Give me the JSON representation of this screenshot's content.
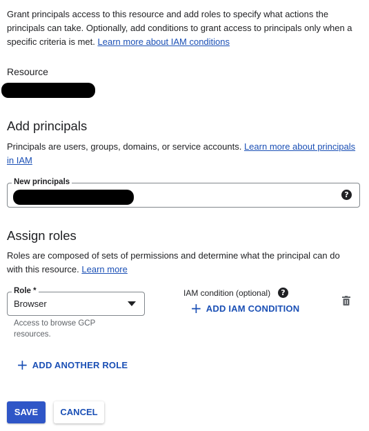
{
  "intro": {
    "text": "Grant principals access to this resource and add roles to specify what actions the principals can take. Optionally, add conditions to grant access to principals only when a specific criteria is met.",
    "link": "Learn more about IAM conditions"
  },
  "resource": {
    "label": "Resource"
  },
  "add_principals": {
    "heading": "Add principals",
    "description": "Principals are users, groups, domains, or service accounts.",
    "link": "Learn more about principals in IAM",
    "field_label": "New principals"
  },
  "assign_roles": {
    "heading": "Assign roles",
    "description": "Roles are composed of sets of permissions and determine what the principal can do with this resource.",
    "link": "Learn more",
    "role_label": "Role *",
    "role_value": "Browser",
    "role_hint": "Access to browse GCP resources.",
    "iam_condition_label": "IAM condition (optional)",
    "add_condition": "ADD IAM CONDITION",
    "add_role": "ADD ANOTHER ROLE"
  },
  "actions": {
    "save": "SAVE",
    "cancel": "CANCEL"
  },
  "icons": {
    "help": "help-icon",
    "dropdown": "caret-down-icon",
    "delete": "trash-icon",
    "add": "plus-icon"
  },
  "colors": {
    "accent": "#1a4fb5",
    "primary_button": "#2f56c7"
  }
}
